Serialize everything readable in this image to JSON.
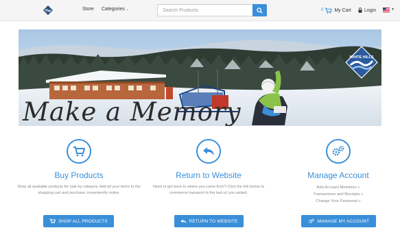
{
  "navbar": {
    "store_label": "Store",
    "categories_label": "Categories",
    "search_placeholder": "Search Products",
    "cart_count": "0",
    "cart_label": "My Cart",
    "login_label": "Login"
  },
  "banner": {
    "caption": "Make a Memory",
    "brand_text": "WHITE HILLS"
  },
  "features": [
    {
      "title": "Buy Products",
      "description": "Shop all available products for sale by category. Add all your items to the shopping cart and purchase conveniently online.",
      "button_label": "SHOP ALL PRODUCTS",
      "icon": "cart-icon"
    },
    {
      "title": "Return to Website",
      "description": "Need to get back to where you came from? Click the link below to commence transport to the last url you visited.",
      "button_label": "RETURN TO WEBSITE",
      "icon": "reply-arrow-icon"
    },
    {
      "title": "Manage Account",
      "links": [
        "Add Account Members »",
        "Transactions and Receipts »",
        "Change Your Password »"
      ],
      "button_label": "MANAGE MY ACCOUNT",
      "icon": "gears-icon"
    }
  ],
  "colors": {
    "accent": "#3a8fd8",
    "navbar_bg": "#f5f5f5",
    "muted_text": "#888888"
  }
}
